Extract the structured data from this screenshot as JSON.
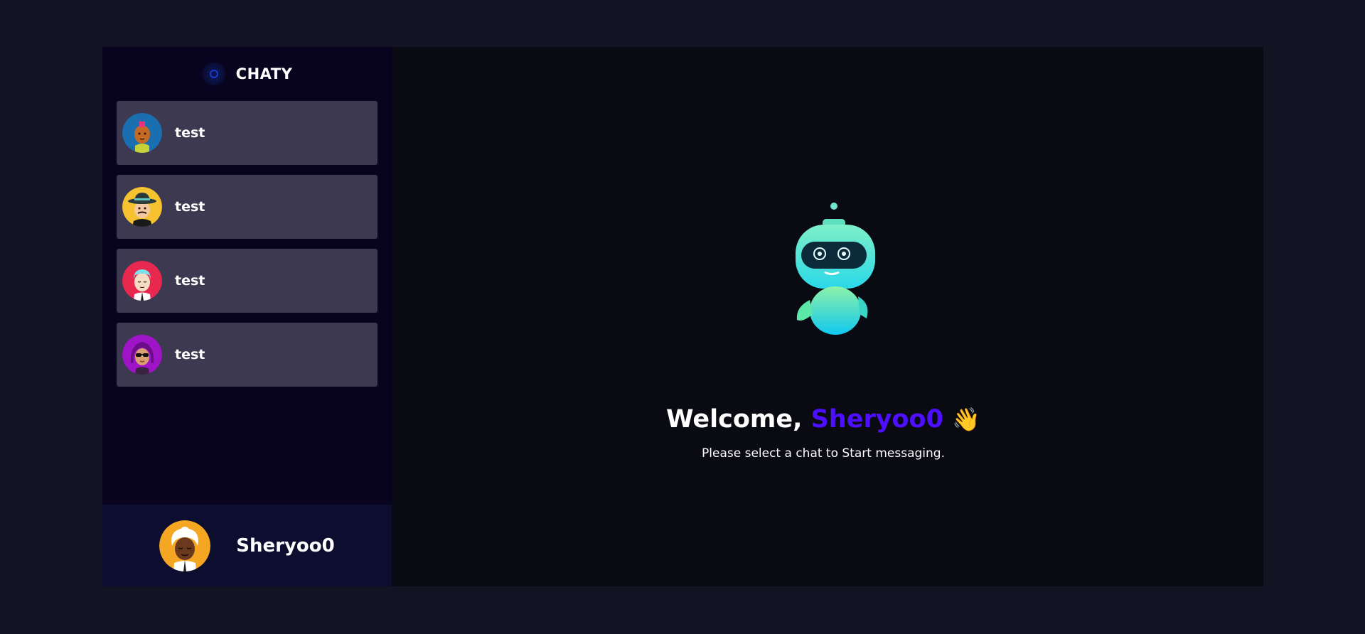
{
  "brand": {
    "name": "CHATY",
    "logo_icon": "planet-logo-icon"
  },
  "contacts": [
    {
      "name": "test",
      "avatar": "avatar-punk-icon",
      "color": "#1a6fb0"
    },
    {
      "name": "test",
      "avatar": "avatar-hat-mustache-icon",
      "color": "#f7c22f"
    },
    {
      "name": "test",
      "avatar": "avatar-blond-shirt-icon",
      "color": "#e8284f"
    },
    {
      "name": "test",
      "avatar": "avatar-sunglasses-icon",
      "color": "#a014c8"
    }
  ],
  "current_user": {
    "username": "Sheryoo0",
    "avatar": "avatar-white-hair-icon",
    "color": "#f5a623"
  },
  "welcome": {
    "greeting": "Welcome,",
    "username": "Sheryoo0",
    "wave": "👋",
    "subtitle": "Please select a chat to Start messaging."
  },
  "colors": {
    "accent": "#4e0eff",
    "sidebar": "#080420",
    "contact_bg": "#3c3950",
    "page_bg": "#131324"
  }
}
